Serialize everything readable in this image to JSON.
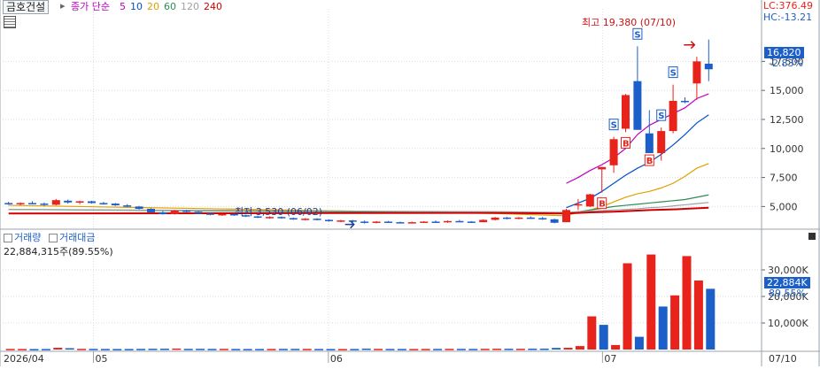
{
  "header": {
    "stock_name": "금호건설",
    "ma_label": "종가 단순",
    "ma_periods": [
      {
        "label": "5",
        "color": "#c000c0"
      },
      {
        "label": "10",
        "color": "#0050c8"
      },
      {
        "label": "20",
        "color": "#e0a000"
      },
      {
        "label": "60",
        "color": "#2e8b57"
      },
      {
        "label": "120",
        "color": "#a0a0a0"
      },
      {
        "label": "240",
        "color": "#d00000"
      }
    ],
    "lc": "LC:376.49",
    "hc": "HC:-13.21"
  },
  "annotations": {
    "high": "최고 19,380 (07/10)",
    "low": "최저 3,530 (06/02)"
  },
  "price_tag": {
    "value": "16,820",
    "change": "-2.83%"
  },
  "volume_panel": {
    "title1": "거래량",
    "title2": "거래대금",
    "readout": "22,884,315주(89.55%)",
    "tag_value": "22,884K",
    "tag_pct": "89.55%"
  },
  "colors": {
    "up": "#e8231b",
    "down": "#1d5fc9",
    "grid": "#d9dde3"
  },
  "chart_data": [
    {
      "type": "candlestick",
      "ylim": [
        3200,
        20500
      ],
      "y_ticks": [
        5000,
        7500,
        10000,
        12500,
        15000,
        17500
      ],
      "y_tick_labels": [
        "5,000",
        "7,500",
        "10,000",
        "12,500",
        "15,000",
        "17,500"
      ],
      "x_labels": [
        "2026/04",
        "05",
        "06",
        "07",
        "07/10"
      ],
      "candles": [
        {
          "o": 5300,
          "h": 5400,
          "l": 5150,
          "c": 5250
        },
        {
          "o": 5200,
          "h": 5350,
          "l": 5100,
          "c": 5300
        },
        {
          "o": 5300,
          "h": 5450,
          "l": 5200,
          "c": 5250
        },
        {
          "o": 5250,
          "h": 5350,
          "l": 5050,
          "c": 5150
        },
        {
          "o": 5150,
          "h": 5650,
          "l": 5100,
          "c": 5550
        },
        {
          "o": 5500,
          "h": 5600,
          "l": 5250,
          "c": 5350
        },
        {
          "o": 5350,
          "h": 5500,
          "l": 5200,
          "c": 5450
        },
        {
          "o": 5450,
          "h": 5500,
          "l": 5250,
          "c": 5300
        },
        {
          "o": 5300,
          "h": 5400,
          "l": 5150,
          "c": 5250
        },
        {
          "o": 5250,
          "h": 5300,
          "l": 5050,
          "c": 5100
        },
        {
          "o": 5100,
          "h": 5200,
          "l": 4950,
          "c": 5000
        },
        {
          "o": 5000,
          "h": 5050,
          "l": 4750,
          "c": 4800
        },
        {
          "o": 4800,
          "h": 4850,
          "l": 4450,
          "c": 4500
        },
        {
          "o": 4500,
          "h": 4600,
          "l": 4300,
          "c": 4350
        },
        {
          "o": 4350,
          "h": 4700,
          "l": 4300,
          "c": 4650
        },
        {
          "o": 4650,
          "h": 4700,
          "l": 4500,
          "c": 4550
        },
        {
          "o": 4550,
          "h": 4600,
          "l": 4350,
          "c": 4400
        },
        {
          "o": 4400,
          "h": 4450,
          "l": 4250,
          "c": 4300
        },
        {
          "o": 4300,
          "h": 4400,
          "l": 4200,
          "c": 4350
        },
        {
          "o": 4350,
          "h": 4400,
          "l": 4200,
          "c": 4250
        },
        {
          "o": 4250,
          "h": 4300,
          "l": 4100,
          "c": 4150
        },
        {
          "o": 4150,
          "h": 4200,
          "l": 4000,
          "c": 4050
        },
        {
          "o": 4050,
          "h": 4150,
          "l": 3950,
          "c": 4100
        },
        {
          "o": 4100,
          "h": 4150,
          "l": 3950,
          "c": 4000
        },
        {
          "o": 4000,
          "h": 4050,
          "l": 3850,
          "c": 3900
        },
        {
          "o": 3900,
          "h": 4000,
          "l": 3800,
          "c": 3950
        },
        {
          "o": 3950,
          "h": 4000,
          "l": 3800,
          "c": 3850
        },
        {
          "o": 3850,
          "h": 3900,
          "l": 3700,
          "c": 3750
        },
        {
          "o": 3750,
          "h": 3850,
          "l": 3650,
          "c": 3800
        },
        {
          "o": 3800,
          "h": 3850,
          "l": 3650,
          "c": 3700
        },
        {
          "o": 3700,
          "h": 3800,
          "l": 3530,
          "c": 3600
        },
        {
          "o": 3600,
          "h": 3750,
          "l": 3550,
          "c": 3700
        },
        {
          "o": 3700,
          "h": 3750,
          "l": 3600,
          "c": 3650
        },
        {
          "o": 3650,
          "h": 3700,
          "l": 3550,
          "c": 3600
        },
        {
          "o": 3600,
          "h": 3700,
          "l": 3550,
          "c": 3650
        },
        {
          "o": 3650,
          "h": 3750,
          "l": 3600,
          "c": 3700
        },
        {
          "o": 3700,
          "h": 3800,
          "l": 3600,
          "c": 3650
        },
        {
          "o": 3650,
          "h": 3800,
          "l": 3600,
          "c": 3750
        },
        {
          "o": 3750,
          "h": 3850,
          "l": 3650,
          "c": 3700
        },
        {
          "o": 3700,
          "h": 3750,
          "l": 3600,
          "c": 3650
        },
        {
          "o": 3650,
          "h": 3900,
          "l": 3650,
          "c": 3850
        },
        {
          "o": 3850,
          "h": 4100,
          "l": 3800,
          "c": 4050
        },
        {
          "o": 4050,
          "h": 4100,
          "l": 3900,
          "c": 3950
        },
        {
          "o": 3950,
          "h": 4100,
          "l": 3900,
          "c": 4050
        },
        {
          "o": 4050,
          "h": 4150,
          "l": 3950,
          "c": 4000
        },
        {
          "o": 4000,
          "h": 4100,
          "l": 3850,
          "c": 3900
        },
        {
          "o": 3900,
          "h": 3950,
          "l": 3550,
          "c": 3600
        },
        {
          "o": 3650,
          "h": 4800,
          "l": 3650,
          "c": 4700
        },
        {
          "o": 5150,
          "h": 5650,
          "l": 4700,
          "c": 5200
        },
        {
          "o": 5000,
          "h": 6100,
          "l": 4950,
          "c": 6050
        },
        {
          "o": 8200,
          "h": 8400,
          "l": 6200,
          "c": 8400
        },
        {
          "o": 8550,
          "h": 11000,
          "l": 7900,
          "c": 10800
        },
        {
          "o": 11700,
          "h": 14700,
          "l": 11400,
          "c": 14600
        },
        {
          "o": 15800,
          "h": 18800,
          "l": 12100,
          "c": 11600
        },
        {
          "o": 11300,
          "h": 13300,
          "l": 9900,
          "c": 9600
        },
        {
          "o": 9600,
          "h": 11800,
          "l": 8950,
          "c": 11500
        },
        {
          "o": 11500,
          "h": 15500,
          "l": 11300,
          "c": 14100
        },
        {
          "o": 14100,
          "h": 14400,
          "l": 13900,
          "c": 14000
        },
        {
          "o": 15600,
          "h": 17900,
          "l": 14200,
          "c": 17500
        },
        {
          "o": 17300,
          "h": 19380,
          "l": 15800,
          "c": 16820
        }
      ],
      "ma_lines": [
        {
          "period": 5,
          "values": [
            7000,
            7500,
            8100,
            8600,
            9200,
            10000,
            11200,
            12000,
            12500,
            13000,
            13500,
            14300,
            14700
          ]
        },
        {
          "period": 10,
          "values": [
            4900,
            5300,
            5700,
            6300,
            7000,
            7700,
            8300,
            8800,
            9500,
            10300,
            11200,
            12200,
            12900
          ]
        },
        {
          "period": 20,
          "values": [
            4200,
            4500,
            4700,
            5000,
            5400,
            5800,
            6100,
            6300,
            6600,
            7000,
            7600,
            8300,
            8700
          ]
        },
        {
          "period": 60,
          "values": [
            4400,
            4550,
            4700,
            4850,
            5000,
            5100,
            5200,
            5300,
            5400,
            5500,
            5600,
            5800,
            6000
          ]
        },
        {
          "period": 120,
          "values": [
            4500,
            4550,
            4600,
            4650,
            4700,
            4750,
            4800,
            4900,
            4950,
            5050,
            5150,
            5250,
            5350
          ]
        },
        {
          "period": 240,
          "values": [
            4400,
            4450,
            4500,
            4520,
            4550,
            4600,
            4650,
            4700,
            4720,
            4750,
            4800,
            4850,
            4900
          ]
        }
      ],
      "markers": [
        {
          "index": 50,
          "type": "B"
        },
        {
          "index": 51,
          "type": "S"
        },
        {
          "index": 52,
          "type": "B"
        },
        {
          "index": 53,
          "type": "S"
        },
        {
          "index": 54,
          "type": "B"
        },
        {
          "index": 55,
          "type": "S"
        },
        {
          "index": 56,
          "type": "S"
        }
      ]
    },
    {
      "type": "bar",
      "ylim": [
        0,
        40000
      ],
      "y_ticks": [
        10000,
        20000,
        30000
      ],
      "y_tick_labels": [
        "10,000K",
        "20,000K",
        "30,000K"
      ],
      "values": [
        230,
        210,
        180,
        200,
        650,
        500,
        260,
        240,
        220,
        200,
        210,
        250,
        300,
        320,
        380,
        260,
        280,
        240,
        260,
        220,
        200,
        210,
        230,
        250,
        260,
        240,
        220,
        200,
        190,
        210,
        350,
        250,
        230,
        220,
        210,
        230,
        240,
        260,
        250,
        230,
        280,
        310,
        300,
        290,
        320,
        340,
        600,
        650,
        1300,
        12500,
        9300,
        1700,
        32500,
        4800,
        35800,
        16200,
        20400,
        35200,
        26000,
        22884
      ],
      "volume_up": [
        true,
        true,
        false,
        false,
        true,
        false,
        true,
        false,
        false,
        false,
        false,
        false,
        false,
        false,
        true,
        false,
        false,
        false,
        true,
        false,
        false,
        false,
        true,
        false,
        false,
        true,
        false,
        false,
        true,
        false,
        false,
        true,
        false,
        false,
        true,
        true,
        false,
        true,
        false,
        false,
        true,
        true,
        false,
        true,
        false,
        false,
        false,
        true,
        true,
        true,
        false,
        true,
        true,
        false,
        true,
        false,
        true,
        true,
        true,
        false
      ]
    }
  ]
}
